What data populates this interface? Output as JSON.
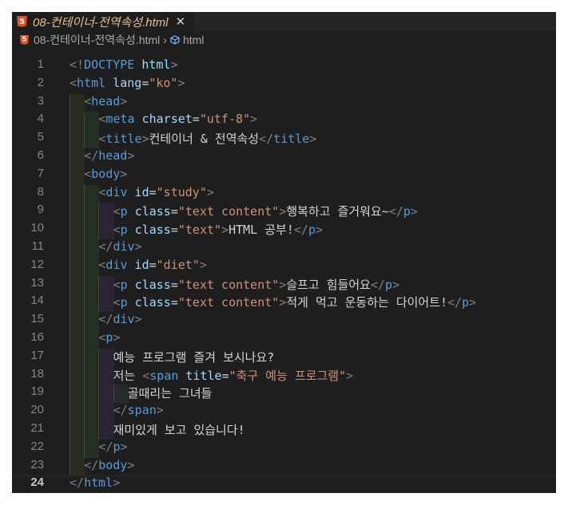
{
  "tab": {
    "title": "08-컨테이너-전역속성.html",
    "close": "✕",
    "icon_label": "5"
  },
  "breadcrumb": {
    "file": "08-컨테이너-전역속성.html",
    "sep": "›",
    "symbol": "html"
  },
  "lines": [
    {
      "n": "1",
      "t": [
        [
          "t",
          "<!"
        ],
        [
          "tag",
          "DOCTYPE "
        ],
        [
          "attr",
          "html"
        ],
        [
          "t",
          ">"
        ]
      ]
    },
    {
      "n": "2",
      "t": [
        [
          "t",
          "<"
        ],
        [
          "tag",
          "html "
        ],
        [
          "attr",
          "lang"
        ],
        [
          "txt",
          "="
        ],
        [
          "str",
          "\"ko\""
        ],
        [
          "t",
          ">"
        ]
      ]
    },
    {
      "n": "3",
      "t": [
        [
          "t",
          "<"
        ],
        [
          "tag",
          "head"
        ],
        [
          "t",
          ">"
        ]
      ]
    },
    {
      "n": "4",
      "t": [
        [
          "t",
          "<"
        ],
        [
          "tag",
          "meta "
        ],
        [
          "attr",
          "charset"
        ],
        [
          "txt",
          "="
        ],
        [
          "str",
          "\"utf-8\""
        ],
        [
          "t",
          ">"
        ]
      ]
    },
    {
      "n": "5",
      "t": [
        [
          "t",
          "<"
        ],
        [
          "tag",
          "title"
        ],
        [
          "t",
          ">"
        ],
        [
          "txt",
          "컨테이너 & 전역속성"
        ],
        [
          "t",
          "</"
        ],
        [
          "tag",
          "title"
        ],
        [
          "t",
          ">"
        ]
      ]
    },
    {
      "n": "6",
      "t": [
        [
          "t",
          "</"
        ],
        [
          "tag",
          "head"
        ],
        [
          "t",
          ">"
        ]
      ]
    },
    {
      "n": "7",
      "t": [
        [
          "t",
          "<"
        ],
        [
          "tag",
          "body"
        ],
        [
          "t",
          ">"
        ]
      ]
    },
    {
      "n": "8",
      "t": [
        [
          "t",
          "<"
        ],
        [
          "tag",
          "div "
        ],
        [
          "attr",
          "id"
        ],
        [
          "txt",
          "="
        ],
        [
          "str",
          "\"study\""
        ],
        [
          "t",
          ">"
        ]
      ]
    },
    {
      "n": "9",
      "t": [
        [
          "t",
          "<"
        ],
        [
          "tag",
          "p "
        ],
        [
          "attr",
          "class"
        ],
        [
          "txt",
          "="
        ],
        [
          "str",
          "\"text content\""
        ],
        [
          "t",
          ">"
        ],
        [
          "txt",
          "행복하고 즐거워요~"
        ],
        [
          "t",
          "</"
        ],
        [
          "tag",
          "p"
        ],
        [
          "t",
          ">"
        ]
      ]
    },
    {
      "n": "10",
      "t": [
        [
          "t",
          "<"
        ],
        [
          "tag",
          "p "
        ],
        [
          "attr",
          "class"
        ],
        [
          "txt",
          "="
        ],
        [
          "str",
          "\"text\""
        ],
        [
          "t",
          ">"
        ],
        [
          "txt",
          "HTML 공부!"
        ],
        [
          "t",
          "</"
        ],
        [
          "tag",
          "p"
        ],
        [
          "t",
          ">"
        ]
      ]
    },
    {
      "n": "11",
      "t": [
        [
          "t",
          "</"
        ],
        [
          "tag",
          "div"
        ],
        [
          "t",
          ">"
        ]
      ]
    },
    {
      "n": "12",
      "t": [
        [
          "t",
          "<"
        ],
        [
          "tag",
          "div "
        ],
        [
          "attr",
          "id"
        ],
        [
          "txt",
          "="
        ],
        [
          "str",
          "\"diet\""
        ],
        [
          "t",
          ">"
        ]
      ]
    },
    {
      "n": "13",
      "t": [
        [
          "t",
          "<"
        ],
        [
          "tag",
          "p "
        ],
        [
          "attr",
          "class"
        ],
        [
          "txt",
          "="
        ],
        [
          "str",
          "\"text content\""
        ],
        [
          "t",
          ">"
        ],
        [
          "txt",
          "슬프고 힘들어요"
        ],
        [
          "t",
          "</"
        ],
        [
          "tag",
          "p"
        ],
        [
          "t",
          ">"
        ]
      ]
    },
    {
      "n": "14",
      "t": [
        [
          "t",
          "<"
        ],
        [
          "tag",
          "p "
        ],
        [
          "attr",
          "class"
        ],
        [
          "txt",
          "="
        ],
        [
          "str",
          "\"text content\""
        ],
        [
          "t",
          ">"
        ],
        [
          "txt",
          "적게 먹고 운동하는 다이어트!"
        ],
        [
          "t",
          "</"
        ],
        [
          "tag",
          "p"
        ],
        [
          "t",
          ">"
        ]
      ]
    },
    {
      "n": "15",
      "t": [
        [
          "t",
          "</"
        ],
        [
          "tag",
          "div"
        ],
        [
          "t",
          ">"
        ]
      ]
    },
    {
      "n": "16",
      "t": [
        [
          "t",
          "<"
        ],
        [
          "tag",
          "p"
        ],
        [
          "t",
          ">"
        ]
      ]
    },
    {
      "n": "17",
      "t": [
        [
          "txt",
          "예능 프로그램 즐겨 보시나요?"
        ]
      ]
    },
    {
      "n": "18",
      "t": [
        [
          "txt",
          "저는 "
        ],
        [
          "t",
          "<"
        ],
        [
          "tag",
          "span "
        ],
        [
          "attr",
          "title"
        ],
        [
          "txt",
          "="
        ],
        [
          "str",
          "\"축구 예능 프로그램\""
        ],
        [
          "t",
          ">"
        ]
      ]
    },
    {
      "n": "19",
      "t": [
        [
          "txt",
          "골때리는 그녀들"
        ]
      ]
    },
    {
      "n": "20",
      "t": [
        [
          "t",
          "</"
        ],
        [
          "tag",
          "span"
        ],
        [
          "t",
          ">"
        ]
      ]
    },
    {
      "n": "21",
      "t": [
        [
          "txt",
          "재미있게 보고 있습니다!"
        ]
      ]
    },
    {
      "n": "22",
      "t": [
        [
          "t",
          "</"
        ],
        [
          "tag",
          "p"
        ],
        [
          "t",
          ">"
        ]
      ]
    },
    {
      "n": "23",
      "t": [
        [
          "t",
          "</"
        ],
        [
          "tag",
          "body"
        ],
        [
          "t",
          ">"
        ]
      ]
    },
    {
      "n": "24",
      "t": [
        [
          "t",
          "</"
        ],
        [
          "tag",
          "html"
        ],
        [
          "t",
          ">"
        ]
      ]
    }
  ]
}
